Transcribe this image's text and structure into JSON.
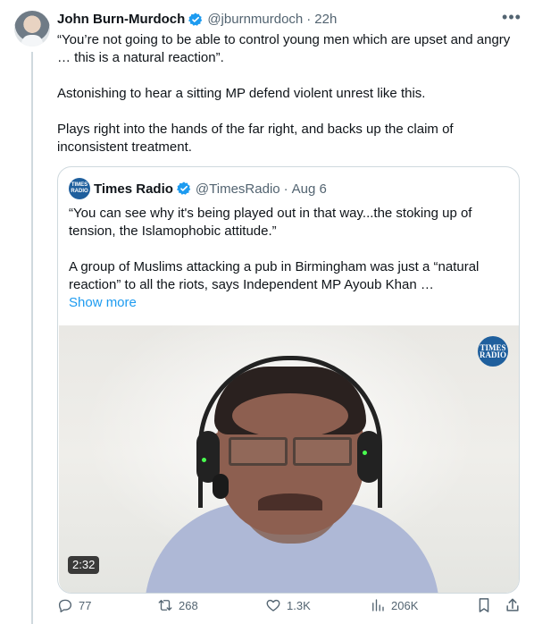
{
  "tweet": {
    "author_name": "John Burn-Murdoch",
    "handle": "@jburnmurdoch",
    "separator": "·",
    "time": "22h",
    "more_icon": "more-horizontal-icon",
    "text_paragraphs": [
      "“You’re not going to be able to control young men which are upset and angry … this is a natural reaction”.",
      "Astonishing to hear a sitting MP defend violent unrest like this.",
      "Plays right into the hands of the far right, and backs up the claim of inconsistent treatment."
    ]
  },
  "quoted_tweet": {
    "author_name": "Times Radio",
    "handle": "@TimesRadio",
    "separator": "·",
    "date": "Aug 6",
    "logo_lines": [
      "TIMES",
      "RADIO"
    ],
    "text_paragraphs": [
      "“You can see why it's being played out in that way...the stoking up of tension, the Islamophobic attitude.”",
      "A group of Muslims attacking a pub in Birmingham was just a “natural reaction” to all the riots, says Independent MP Ayoub Khan …"
    ],
    "show_more": "Show more",
    "video": {
      "duration": "2:32",
      "watermark_lines": [
        "TIMES",
        "RADIO"
      ]
    }
  },
  "actions": {
    "replies": "77",
    "retweets": "268",
    "likes": "1.3K",
    "views": "206K"
  },
  "colors": {
    "text": "#0f1419",
    "secondary_text": "#536471",
    "link": "#1d9bf0",
    "verified": "#1d9bf0",
    "border": "#cfd9de",
    "times_radio_blue": "#1f5f9d"
  }
}
